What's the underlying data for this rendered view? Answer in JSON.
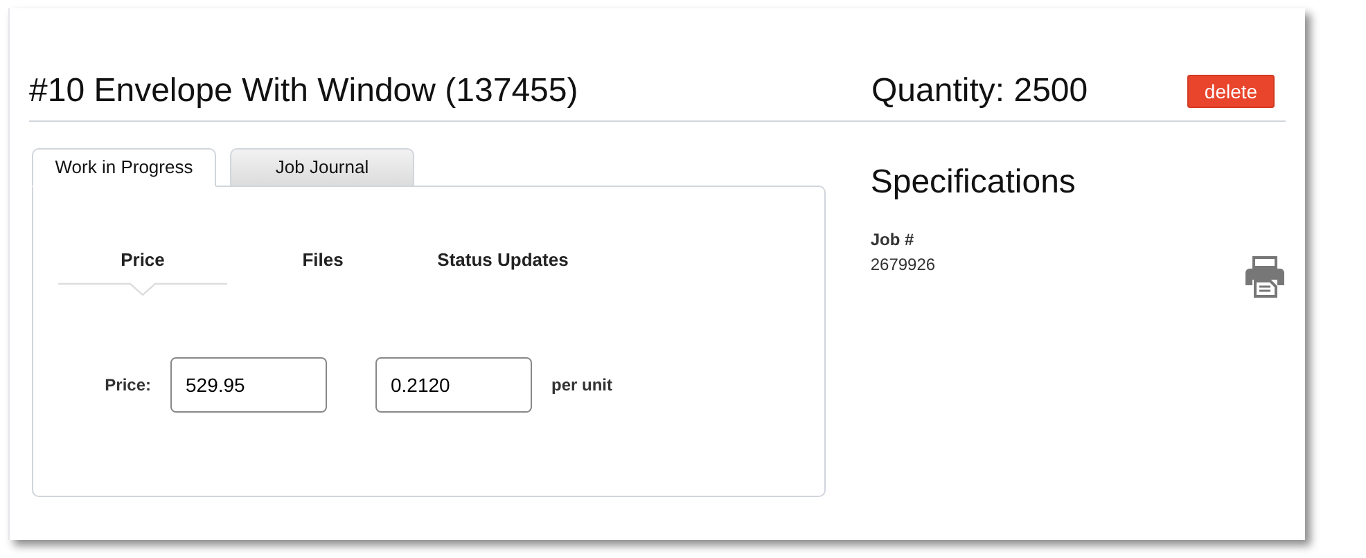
{
  "header": {
    "title": "#10 Envelope With Window (137455)",
    "quantity": "Quantity: 2500",
    "delete_button": "delete"
  },
  "tabs": [
    {
      "label": "Work in Progress",
      "selected": true
    },
    {
      "label": "Job Journal",
      "selected": false
    }
  ],
  "subtabs": [
    {
      "label": "Price",
      "selected": true
    },
    {
      "label": "Files",
      "selected": false
    },
    {
      "label": "Status Updates",
      "selected": false
    }
  ],
  "price_form": {
    "label": "Price:",
    "total": "529.95",
    "unit_price": "0.2120",
    "unit_label": "per unit"
  },
  "specifications": {
    "title": "Specifications",
    "fields": [
      {
        "label": "Job #",
        "value": "2679926"
      }
    ]
  }
}
